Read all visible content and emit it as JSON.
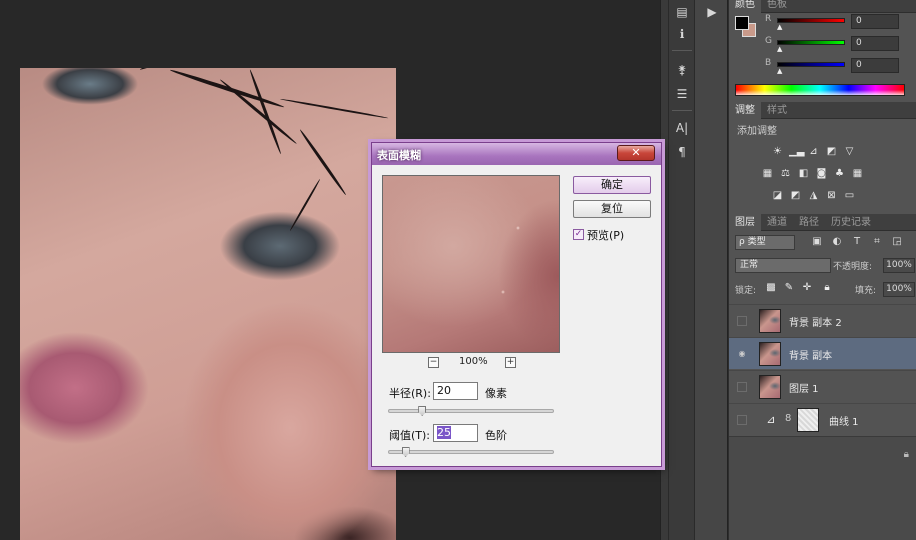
{
  "color_panel": {
    "tabs": [
      "颜色",
      "色板"
    ],
    "fg_color": "#000000",
    "bg_color": "#c99a8a",
    "channels": [
      {
        "label": "R",
        "value": "0",
        "bar": "#ff0000"
      },
      {
        "label": "G",
        "value": "0",
        "bar": "#00ff00"
      },
      {
        "label": "B",
        "value": "0",
        "bar": "#0000ff"
      }
    ]
  },
  "adjustments_panel": {
    "tabs": [
      "调整",
      "样式"
    ],
    "title": "添加调整",
    "row1": [
      "brightness-icon",
      "levels-icon",
      "curves-icon",
      "exposure-icon",
      "vibrance-icon"
    ],
    "row2": [
      "hue-saturation-icon",
      "color-balance-icon",
      "black-white-icon",
      "photo-filter-icon",
      "channel-mixer-icon",
      "color-lookup-icon"
    ],
    "row3": [
      "invert-icon",
      "posterize-icon",
      "threshold-icon",
      "selective-color-icon",
      "gradient-map-icon"
    ]
  },
  "layers_panel": {
    "tabs": [
      "图层",
      "通道",
      "路径",
      "历史记录"
    ],
    "kind": "ρ 类型",
    "blend_mode": "正常",
    "opacity_label": "不透明度:",
    "opacity": "100%",
    "lock_label": "锁定:",
    "fill_label": "填充:",
    "fill": "100%",
    "layers": [
      {
        "name": "背景 副本 2",
        "visible": false,
        "selected": false,
        "type": "pixel"
      },
      {
        "name": "背景 副本",
        "visible": true,
        "selected": true,
        "type": "pixel"
      },
      {
        "name": "图层 1",
        "visible": false,
        "selected": false,
        "type": "pixel"
      },
      {
        "name": "曲线 1",
        "visible": false,
        "selected": false,
        "type": "adjustment"
      }
    ]
  },
  "dialog": {
    "title": "表面模糊",
    "close_label": "✕",
    "ok_label": "确定",
    "reset_label": "复位",
    "preview_label": "预览(P)",
    "preview_checked": true,
    "zoom_level": "100%",
    "radius_label": "半径(R):",
    "radius_value": "20",
    "radius_unit": "像素",
    "radius_fraction": 0.2,
    "threshold_label": "阈值(T):",
    "threshold_value": "25",
    "threshold_unit": "色阶",
    "threshold_fraction": 0.1
  },
  "accent": "#a874be"
}
